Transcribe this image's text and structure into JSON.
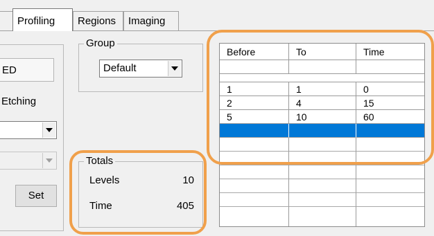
{
  "tabs": [
    {
      "label": "Profiling",
      "active": true
    },
    {
      "label": "Regions",
      "active": false
    },
    {
      "label": "Imaging",
      "active": false
    }
  ],
  "left": {
    "field_value": "ED",
    "label": "Etching",
    "set_button": "Set"
  },
  "group": {
    "title": "Group",
    "selected": "Default"
  },
  "totals": {
    "title": "Totals",
    "levels_label": "Levels",
    "levels_value": "10",
    "time_label": "Time",
    "time_value": "405"
  },
  "grid": {
    "columns": [
      "Before",
      "To",
      "Time"
    ],
    "rows": [
      [
        "1",
        "1",
        "0"
      ],
      [
        "2",
        "4",
        "15"
      ],
      [
        "5",
        "10",
        "60"
      ]
    ]
  },
  "colors": {
    "highlight": "#f0a04b",
    "selection": "#0078d7"
  }
}
